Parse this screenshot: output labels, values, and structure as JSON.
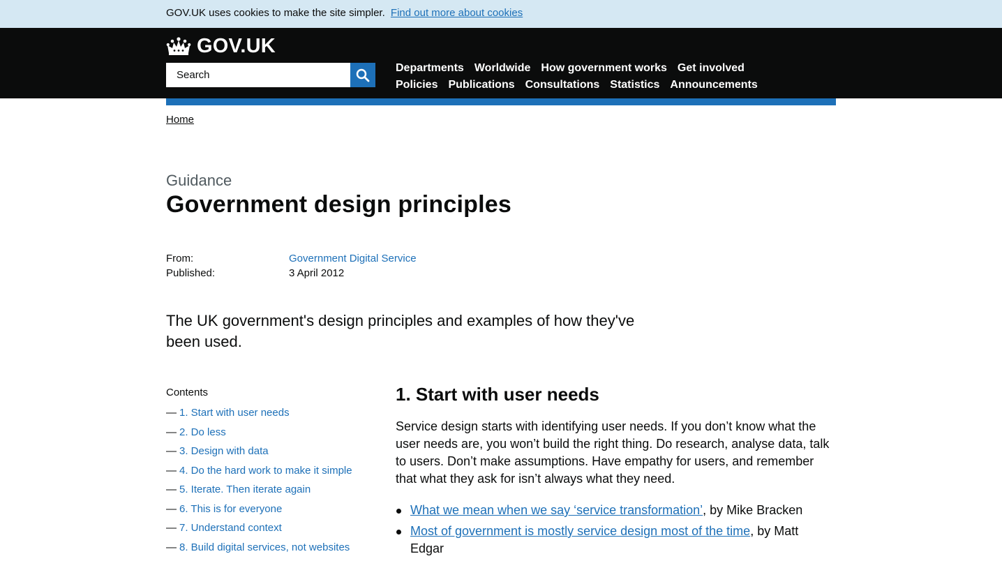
{
  "cookie_banner": {
    "text": "GOV.UK uses cookies to make the site simpler.",
    "link": "Find out more about cookies"
  },
  "header": {
    "logo_text": "GOV.UK",
    "search_placeholder": "Search",
    "nav_row1": [
      "Departments",
      "Worldwide",
      "How government works",
      "Get involved"
    ],
    "nav_row2": [
      "Policies",
      "Publications",
      "Consultations",
      "Statistics",
      "Announcements"
    ]
  },
  "breadcrumb": {
    "home": "Home"
  },
  "page": {
    "doc_type": "Guidance",
    "title": "Government design principles",
    "from_label": "From:",
    "from_value": "Government Digital Service",
    "published_label": "Published:",
    "published_value": "3 April 2012",
    "lead": "The UK government's design principles and examples of how they've been used."
  },
  "contents": {
    "title": "Contents",
    "dash": "—",
    "items": [
      "1. Start with user needs",
      "2. Do less",
      "3. Design with data",
      "4. Do the hard work to make it simple",
      "5. Iterate. Then iterate again",
      "6. This is for everyone",
      "7. Understand context",
      "8. Build digital services, not websites"
    ]
  },
  "section": {
    "heading": "1. Start with user needs",
    "body": "Service design starts with identifying user needs. If you don’t know what the user needs are, you won’t build the right thing. Do research, analyse data, talk to users. Don’t make assumptions. Have empathy for users, and remember that what they ask for isn’t always what they need.",
    "links": [
      {
        "title": "What we mean when we say ‘service transformation’",
        "author": ", by Mike Bracken"
      },
      {
        "title": "Most of government is mostly service design most of the time",
        "author": ", by Matt Edgar"
      }
    ]
  },
  "colors": {
    "link": "#1d70b8",
    "header_bg": "#0b0c0c",
    "cookie_bg": "#d5e8f3",
    "accent_bar": "#1d70b8"
  }
}
